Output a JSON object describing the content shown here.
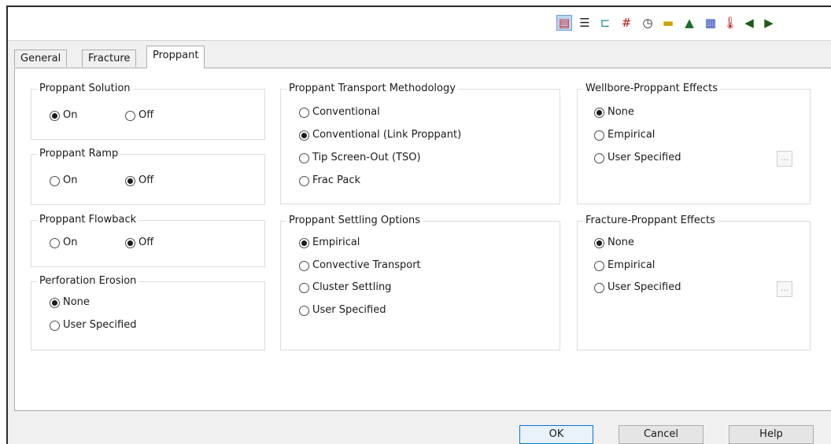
{
  "tabs": [
    {
      "label": "General",
      "active": false
    },
    {
      "label": "Fracture",
      "active": false
    },
    {
      "label": "Proppant",
      "active": true
    }
  ],
  "groups": {
    "proppant_solution": {
      "title": "Proppant Solution",
      "options": [
        {
          "label": "On",
          "checked": true
        },
        {
          "label": "Off",
          "checked": false
        }
      ]
    },
    "proppant_ramp": {
      "title": "Proppant Ramp",
      "options": [
        {
          "label": "On",
          "checked": false
        },
        {
          "label": "Off",
          "checked": true
        }
      ]
    },
    "proppant_flowback": {
      "title": "Proppant Flowback",
      "options": [
        {
          "label": "On",
          "checked": false
        },
        {
          "label": "Off",
          "checked": true
        }
      ]
    },
    "perforation_erosion": {
      "title": "Perforation Erosion",
      "options": [
        {
          "label": "None",
          "checked": true
        },
        {
          "label": "User Specified",
          "checked": false
        }
      ]
    },
    "transport_methodology": {
      "title": "Proppant Transport Methodology",
      "options": [
        {
          "label": "Conventional",
          "checked": false
        },
        {
          "label": "Conventional (Link Proppant)",
          "checked": true
        },
        {
          "label": "Tip Screen-Out (TSO)",
          "checked": false
        },
        {
          "label": "Frac Pack",
          "checked": false
        }
      ]
    },
    "settling_options": {
      "title": "Proppant Settling Options",
      "options": [
        {
          "label": "Empirical",
          "checked": true
        },
        {
          "label": "Convective Transport",
          "checked": false
        },
        {
          "label": "Cluster Settling",
          "checked": false
        },
        {
          "label": "User Specified",
          "checked": false
        }
      ]
    },
    "wellbore_effects": {
      "title": "Wellbore-Proppant Effects",
      "options": [
        {
          "label": "None",
          "checked": true
        },
        {
          "label": "Empirical",
          "checked": false
        },
        {
          "label": "User Specified",
          "checked": false
        }
      ],
      "browse_label": "..."
    },
    "fracture_effects": {
      "title": "Fracture-Proppant Effects",
      "options": [
        {
          "label": "None",
          "checked": true
        },
        {
          "label": "Empirical",
          "checked": false
        },
        {
          "label": "User Specified",
          "checked": false
        }
      ],
      "browse_label": "..."
    }
  },
  "buttons": {
    "ok": "OK",
    "cancel": "Cancel",
    "help": "Help"
  },
  "toolbar_icons": [
    {
      "name": "proppant-view-icon",
      "glyph": "▤",
      "color": "#d42020",
      "active": true
    },
    {
      "name": "layers-icon",
      "glyph": "☰",
      "color": "#222222",
      "active": false
    },
    {
      "name": "wellbore-icon",
      "glyph": "⊏",
      "color": "#1a8f8f",
      "active": false
    },
    {
      "name": "perforation-icon",
      "glyph": "#",
      "color": "#c01818",
      "active": false
    },
    {
      "name": "clock-icon",
      "glyph": "◷",
      "color": "#222222",
      "active": false
    },
    {
      "name": "formation-icon",
      "glyph": "▬",
      "color": "#c9a400",
      "active": false
    },
    {
      "name": "terrain-icon",
      "glyph": "▲",
      "color": "#1a6b2a",
      "active": false
    },
    {
      "name": "grid-map-icon",
      "glyph": "▦",
      "color": "#2345b8",
      "active": false
    },
    {
      "name": "thermometer-icon",
      "glyph": "🌡",
      "color": "#c02020",
      "active": false
    },
    {
      "name": "scroll-left-icon",
      "glyph": "◀",
      "color": "#1b5e1b",
      "active": false
    },
    {
      "name": "scroll-right-icon",
      "glyph": "▶",
      "color": "#1b5e1b",
      "active": false
    }
  ]
}
